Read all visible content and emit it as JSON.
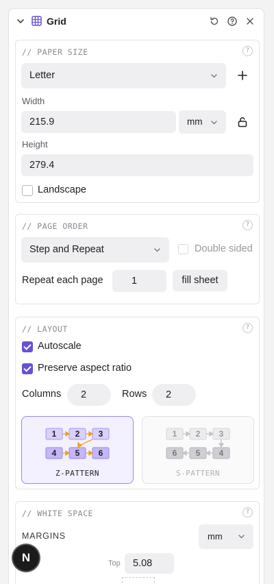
{
  "panel": {
    "title": "Grid",
    "icons": [
      "chevron-down-icon",
      "grid-icon",
      "reset-icon",
      "help-icon",
      "close-icon"
    ]
  },
  "paper_size": {
    "title": "// PAPER SIZE",
    "help": "?",
    "preset": "Letter",
    "width_label": "Width",
    "width_value": "215.9",
    "unit": "mm",
    "height_label": "Height",
    "height_value": "279.4",
    "landscape_label": "Landscape",
    "landscape_checked": false
  },
  "page_order": {
    "title": "// PAGE ORDER",
    "help": "?",
    "mode": "Step and Repeat",
    "double_sided_label": "Double sided",
    "repeat_label": "Repeat each page",
    "repeat_value": "1",
    "fill_sheet_label": "fill sheet"
  },
  "layout": {
    "title": "// LAYOUT",
    "help": "?",
    "autoscale_label": "Autoscale",
    "autoscale_checked": true,
    "preserve_label": "Preserve aspect ratio",
    "preserve_checked": true,
    "columns_label": "Columns",
    "columns_value": "2",
    "rows_label": "Rows",
    "rows_value": "2",
    "z_pattern": {
      "label": "Z-PATTERN",
      "cells": [
        "1",
        "2",
        "3",
        "4",
        "5",
        "6"
      ],
      "selected": true
    },
    "s_pattern": {
      "label": "S-PATTERN",
      "cells": [
        "1",
        "2",
        "3",
        "6",
        "5",
        "4"
      ],
      "selected": false
    }
  },
  "white_space": {
    "title": "// WHITE SPACE",
    "help": "?",
    "margins_label": "MARGINS",
    "unit": "mm",
    "top_label": "Top",
    "top_value": "5.08"
  },
  "badge": {
    "letter": "N"
  },
  "colors": {
    "accent": "#6a4fd8",
    "arrow": "#f0a020",
    "selected_bg": "#f3f0ff"
  }
}
